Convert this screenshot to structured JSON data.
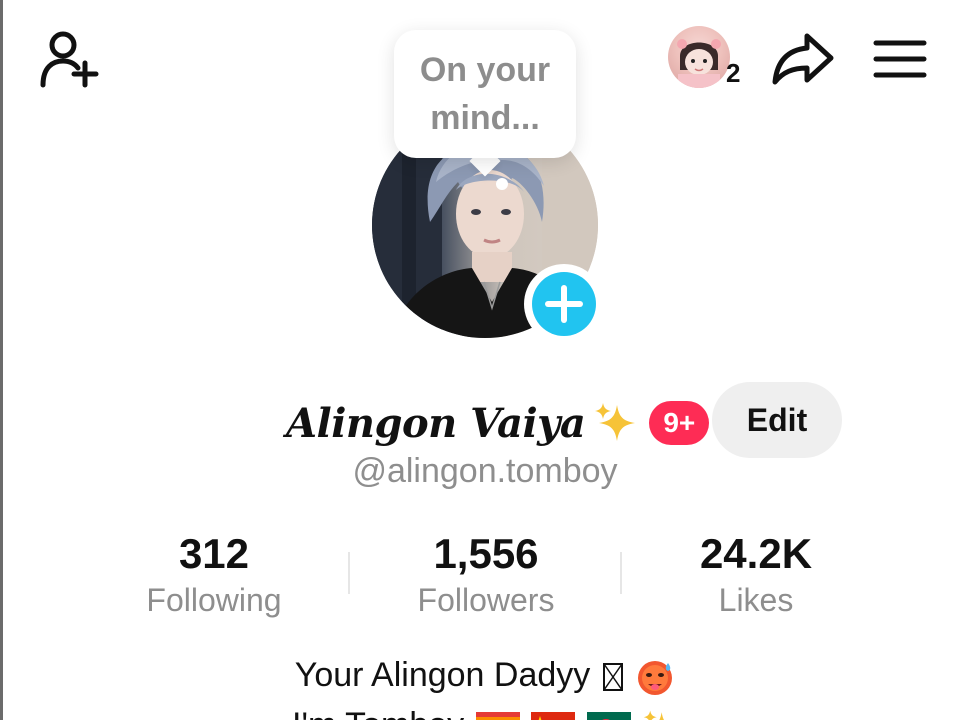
{
  "topbar": {
    "add_friend_icon": "person-add-icon",
    "story_count": "2",
    "share_icon": "share-arrow-icon",
    "menu_icon": "hamburger-menu-icon"
  },
  "bubble": {
    "text": "On your mind..."
  },
  "profile": {
    "display_name": "Alingon Vaiya",
    "badge": "9+",
    "edit_label": "Edit",
    "handle": "@alingon.tomboy"
  },
  "stats": [
    {
      "value": "312",
      "label": "Following"
    },
    {
      "value": "1,556",
      "label": "Followers"
    },
    {
      "value": "24.2K",
      "label": "Likes"
    }
  ],
  "bio": {
    "line1": "Your Alingon Dadyy",
    "line2": "I'm Tomboy"
  },
  "colors": {
    "accent": "#fe2c55",
    "plus": "#21c4f0",
    "muted_text": "#8e8e8e"
  }
}
